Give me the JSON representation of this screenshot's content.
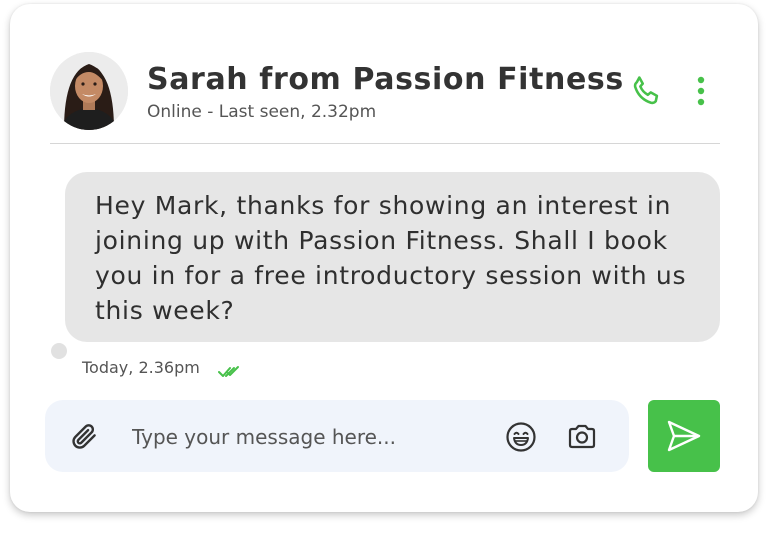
{
  "header": {
    "contact_name": "Sarah from Passion Fitness",
    "status": "Online - Last seen, 2.32pm",
    "avatar_icon": "woman-avatar-photo",
    "call_icon": "phone-icon",
    "menu_icon": "more-vertical-icon"
  },
  "message": {
    "text": "Hey Mark, thanks for showing an interest in joining up with Passion Fitness. Shall I book you in for a free introductory session with us this week?",
    "timestamp": "Today, 2.36pm",
    "read_icon": "double-check-icon"
  },
  "composer": {
    "placeholder": "Type your message here...",
    "attach_icon": "paperclip-icon",
    "emoji_icon": "emoji-icon",
    "camera_icon": "camera-icon",
    "send_icon": "send-icon"
  },
  "colors": {
    "accent": "#47c14a",
    "bubble": "#e6e6e6",
    "input_background": "#f0f4fb"
  }
}
